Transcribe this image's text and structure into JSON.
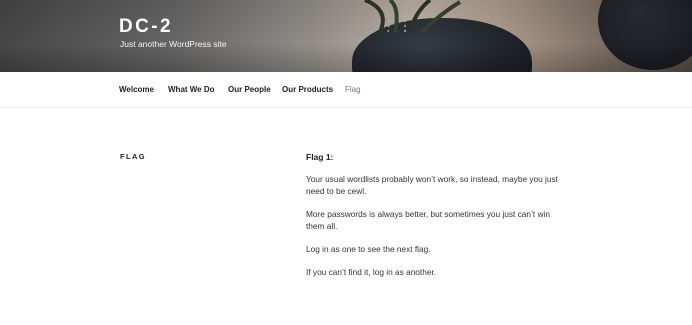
{
  "site": {
    "title": "DC-2",
    "description": "Just another WordPress site"
  },
  "nav": {
    "items": [
      {
        "label": "Welcome"
      },
      {
        "label": "What We Do"
      },
      {
        "label": "Our People"
      },
      {
        "label": "Our Products"
      },
      {
        "label": "Flag",
        "current": true
      }
    ]
  },
  "page": {
    "title": "FLAG",
    "heading": "Flag 1:",
    "paragraphs": [
      "Your usual wordlists probably won’t work, so instead, maybe you just need to be cewl.",
      "More passwords is always better, but sometimes you just can’t win them all.",
      "Log in as one to see the next flag.",
      "If you can’t find it, log in as another."
    ]
  },
  "colors": {
    "text": "#333333",
    "heading": "#222222",
    "nav_current": "#767676",
    "header_text": "#ffffff"
  },
  "header_image": "plant-in-dark-pot-photo"
}
